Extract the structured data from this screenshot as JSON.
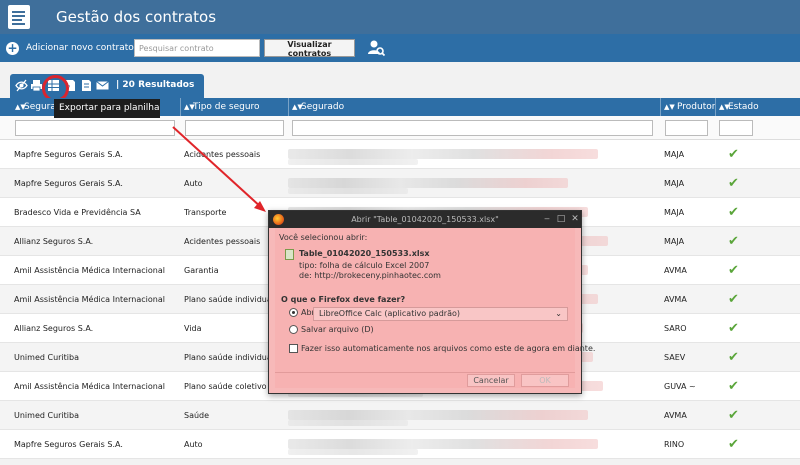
{
  "app": {
    "title": "Gestão dos contratos"
  },
  "toolbar": {
    "add_label": "Adicionar novo contrato",
    "search_placeholder": "Pesquisar contrato",
    "view_button": "Visualizar contratos"
  },
  "results": {
    "count_label": "| 20 Resultados"
  },
  "tooltip": {
    "text": "Exportar para planilha"
  },
  "table": {
    "headers": [
      "Seguradora",
      "Tipo de seguro",
      "Segurado",
      "Produtor",
      "Estado"
    ],
    "rows": [
      {
        "seguradora": "Mapfre Seguros Gerais S.A.",
        "tipo": "Acidentes pessoais",
        "produtor": "MAJA",
        "estado": "✔"
      },
      {
        "seguradora": "Mapfre Seguros Gerais S.A.",
        "tipo": "Auto",
        "produtor": "MAJA",
        "estado": "✔"
      },
      {
        "seguradora": "Bradesco Vida e Previdência SA",
        "tipo": "Transporte",
        "produtor": "MAJA",
        "estado": "✔"
      },
      {
        "seguradora": "Allianz Seguros S.A.",
        "tipo": "Acidentes pessoais",
        "produtor": "MAJA",
        "estado": "✔"
      },
      {
        "seguradora": "Amil Assistência Médica Internacional",
        "tipo": "Garantia",
        "produtor": "AVMA",
        "estado": "✔"
      },
      {
        "seguradora": "Amil Assistência Médica Internacional",
        "tipo": "Plano saúde individual",
        "produtor": "AVMA",
        "estado": "✔"
      },
      {
        "seguradora": "Allianz Seguros S.A.",
        "tipo": "Vida",
        "produtor": "SARO",
        "estado": "✔"
      },
      {
        "seguradora": "Unimed Curitiba",
        "tipo": "Plano saúde individual",
        "produtor": "SAEV",
        "estado": "✔"
      },
      {
        "seguradora": "Amil Assistência Médica Internacional",
        "tipo": "Plano saúde coletivo",
        "produtor": "GUVA ~",
        "estado": "✔"
      },
      {
        "seguradora": "Unimed Curitiba",
        "tipo": "Saúde",
        "produtor": "AVMA",
        "estado": "✔"
      },
      {
        "seguradora": "Mapfre Seguros Gerais S.A.",
        "tipo": "Auto",
        "produtor": "RINO",
        "estado": "✔"
      }
    ]
  },
  "dialog": {
    "title": "Abrir \"Table_01042020_150533.xlsx\"",
    "intro": "Você selecionou abrir:",
    "filename": "Table_01042020_150533.xlsx",
    "type_line": "tipo: folha de cálculo Excel 2007",
    "from_line": "de: http://brokeceny.pinhaotec.com",
    "question": "O que o Firefox deve fazer?",
    "open_with_label": "Abrir com o:",
    "open_with_value": "LibreOffice Calc (aplicativo padrão)",
    "save_label": "Salvar arquivo (D)",
    "auto_label": "Fazer isso automaticamente nos arquivos como este de agora em diante.",
    "cancel": "Cancelar",
    "ok": "OK"
  },
  "colors": {
    "header_blue": "#2d6ea6",
    "title_blue": "#3f6f9b",
    "highlight_red": "#d9252f",
    "dialog_pink": "#f7b9b9",
    "check_green": "#5aa53a"
  }
}
